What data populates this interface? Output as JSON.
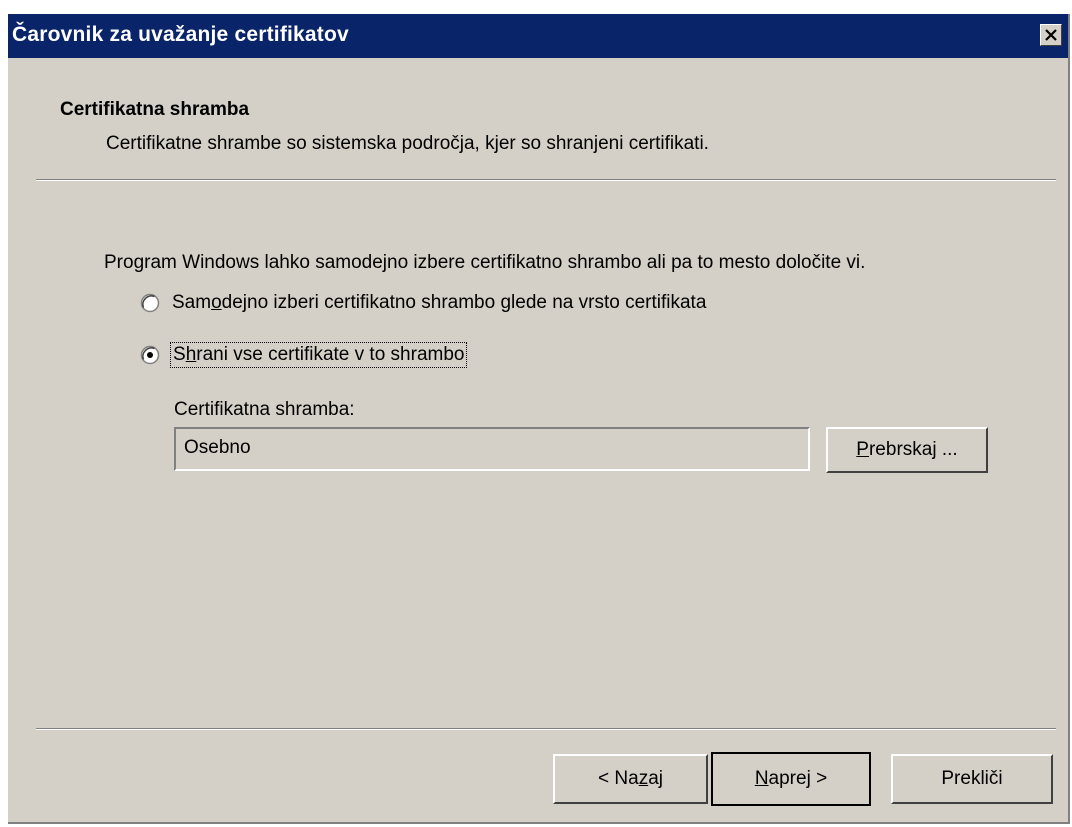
{
  "window": {
    "title": "Čarovnik za uvažanje certifikatov"
  },
  "header": {
    "title": "Certifikatna shramba",
    "subtitle": "Certifikatne shrambe so sistemska področja, kjer so shranjeni certifikati."
  },
  "body": {
    "intro": "Program Windows lahko samodejno izbere certifikatno shrambo ali pa to mesto določite vi.",
    "options": [
      {
        "pre": "Sam",
        "accel": "o",
        "post": "dejno izberi certifikatno shrambo glede na vrsto certifikata",
        "selected": false
      },
      {
        "pre": "S",
        "accel": "h",
        "post": "rani vse certifikate v to shrambo",
        "selected": true
      }
    ],
    "store_label": "Certifikatna shramba:",
    "store_value": "Osebno",
    "browse": {
      "pre": "",
      "accel": "P",
      "post": "rebrskaj ..."
    }
  },
  "footer": {
    "back": {
      "pre": "< Na",
      "accel": "z",
      "post": "aj"
    },
    "next": {
      "pre": "",
      "accel": "N",
      "post": "aprej >"
    },
    "cancel": "Prekliči"
  }
}
